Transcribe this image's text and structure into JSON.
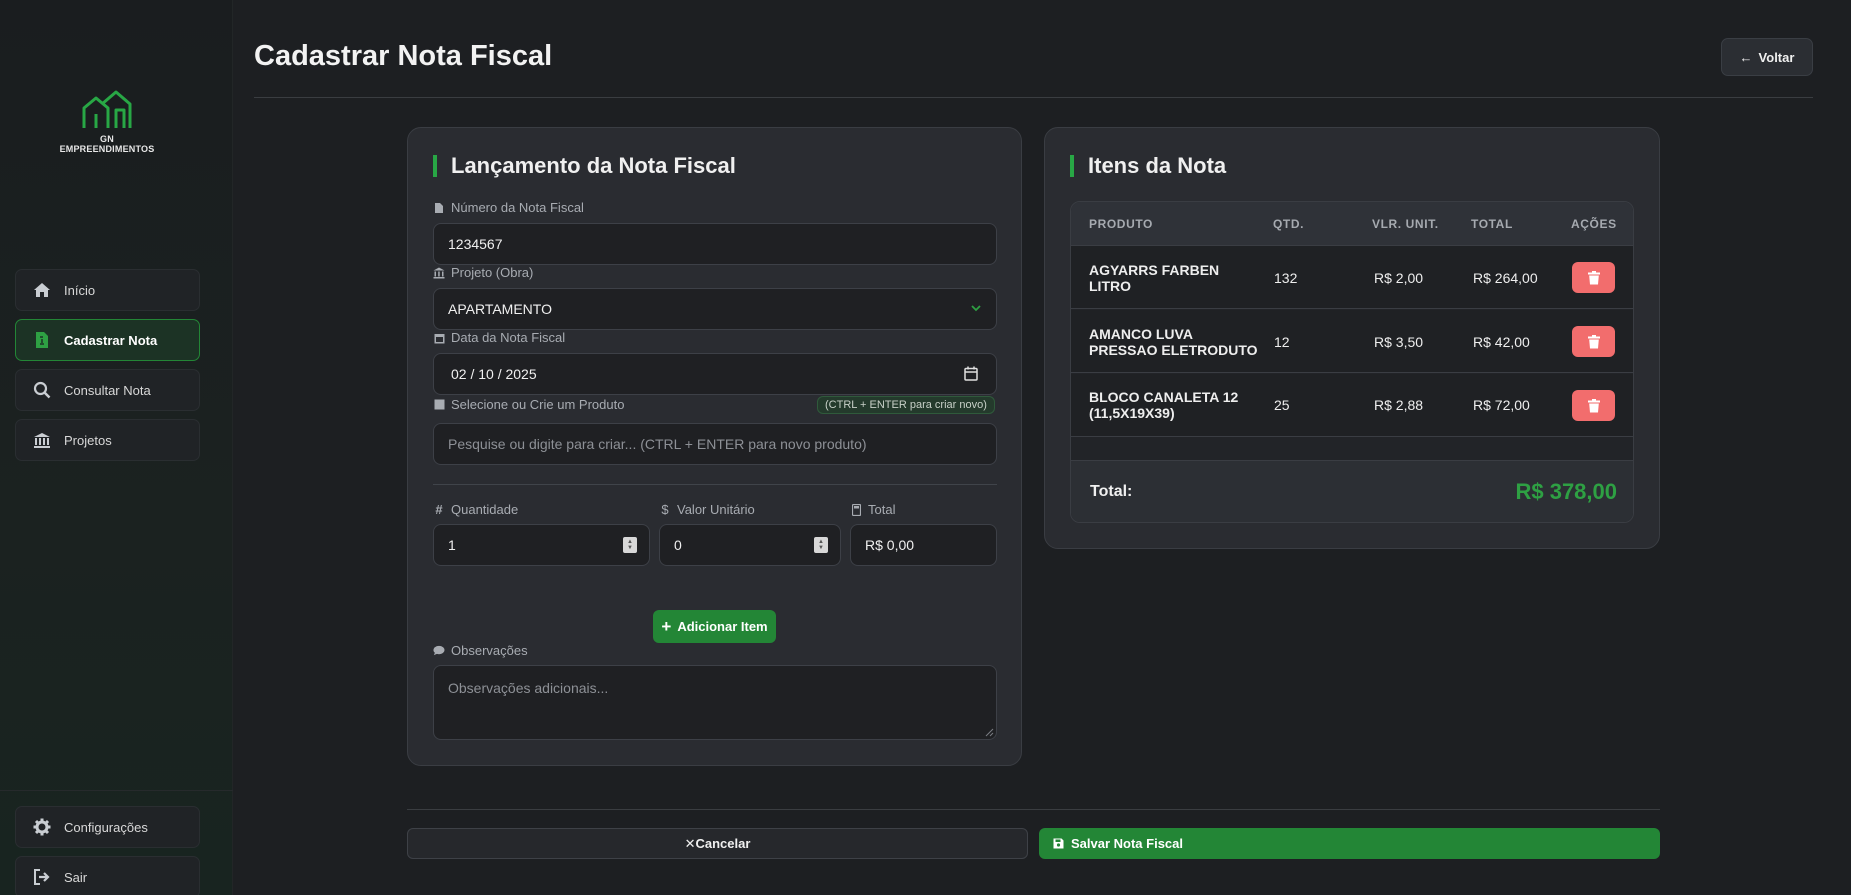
{
  "brand": {
    "name": "GN EMPREENDIMENTOS",
    "accent": "#28a745"
  },
  "sidebar": {
    "items": [
      {
        "label": "Início",
        "icon": "home-icon"
      },
      {
        "label": "Cadastrar Nota",
        "icon": "file-invoice-icon",
        "active": true
      },
      {
        "label": "Consultar Nota",
        "icon": "search-icon"
      },
      {
        "label": "Projetos",
        "icon": "bank-icon"
      }
    ],
    "bottom": [
      {
        "label": "Configurações",
        "icon": "gear-icon"
      },
      {
        "label": "Sair",
        "icon": "logout-icon"
      }
    ]
  },
  "header": {
    "title": "Cadastrar Nota Fiscal",
    "back_label": "Voltar"
  },
  "form": {
    "title": "Lançamento da Nota Fiscal",
    "numero": {
      "label": "Número da Nota Fiscal",
      "value": "1234567"
    },
    "projeto": {
      "label": "Projeto (Obra)",
      "value": "APARTAMENTO"
    },
    "data": {
      "label": "Data da Nota Fiscal",
      "value": "02 / 10 / 2025"
    },
    "produto": {
      "label": "Selecione ou Crie um Produto",
      "hint": "(CTRL + ENTER para criar novo)",
      "placeholder": "Pesquise ou digite para criar... (CTRL + ENTER para novo produto)"
    },
    "quantidade": {
      "label": "Quantidade",
      "value": "1"
    },
    "valor_unitario": {
      "label": "Valor Unitário",
      "value": "0"
    },
    "total": {
      "label": "Total",
      "value": "R$ 0,00"
    },
    "add_label": "Adicionar Item",
    "observacoes": {
      "label": "Observações",
      "placeholder": "Observações adicionais..."
    }
  },
  "items": {
    "title": "Itens da Nota",
    "columns": [
      "PRODUTO",
      "QTD.",
      "VLR. UNIT.",
      "TOTAL",
      "AÇÕES"
    ],
    "rows": [
      {
        "produto": "AGYARRS FARBEN LITRO",
        "qtd": "132",
        "unit": "R$ 2,00",
        "total": "R$ 264,00"
      },
      {
        "produto": "AMANCO LUVA PRESSAO ELETRODUTO",
        "qtd": "12",
        "unit": "R$ 3,50",
        "total": "R$ 42,00"
      },
      {
        "produto": "BLOCO CANALETA 12 (11,5X19X39)",
        "qtd": "25",
        "unit": "R$ 2,88",
        "total": "R$ 72,00"
      }
    ],
    "total_label": "Total:",
    "total_value": "R$ 378,00"
  },
  "footer": {
    "cancel_label": "Cancelar",
    "save_label": "Salvar Nota Fiscal"
  }
}
